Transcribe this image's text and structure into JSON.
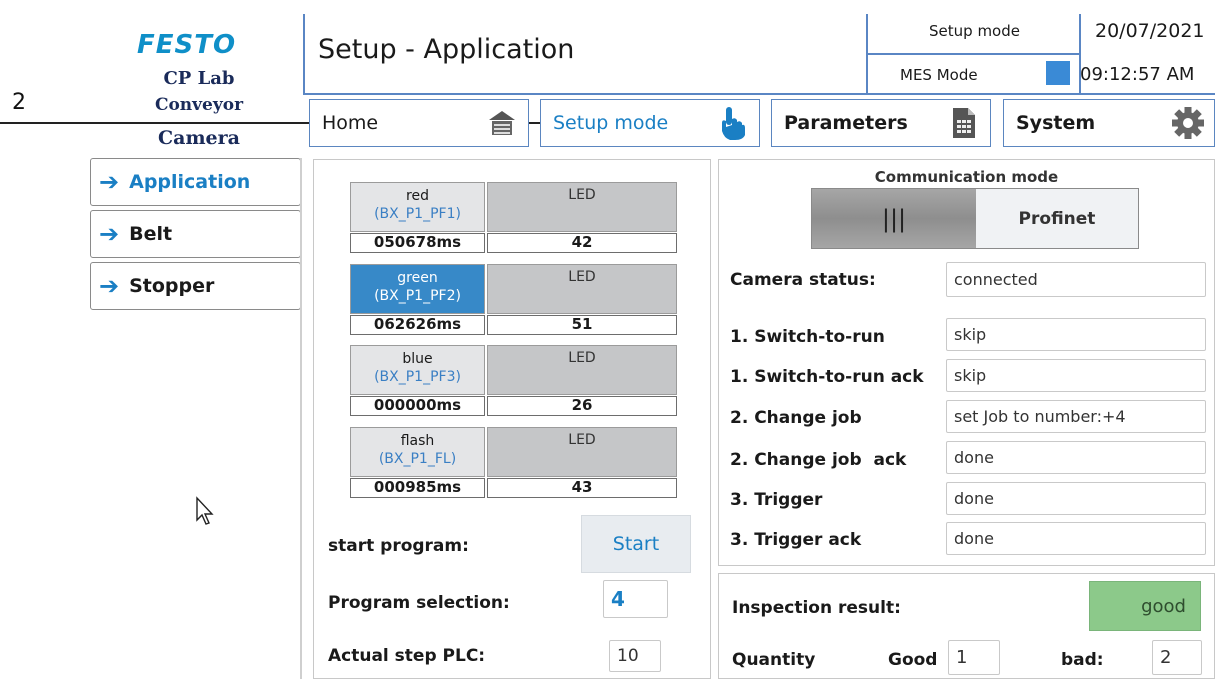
{
  "callout": {
    "number": "2"
  },
  "logo": {
    "brand": "FESTO",
    "product": "CP Lab",
    "station": "Conveyor",
    "module": "Camera"
  },
  "header": {
    "title": "Setup - Application",
    "mode": "Setup mode",
    "mes_label": "MES Mode",
    "date": "20/07/2021",
    "time": "09:12:57 AM",
    "mes_color": "#3a8ad6"
  },
  "nav": {
    "home": {
      "label": "Home",
      "icon": "home-icon"
    },
    "setup": {
      "label": "Setup mode",
      "icon": "hand-pointer-icon"
    },
    "parameters": {
      "label": "Parameters",
      "icon": "document-icon"
    },
    "system": {
      "label": "System",
      "icon": "gear-icon"
    }
  },
  "sidebar": {
    "items": [
      {
        "label": "Application",
        "active": true
      },
      {
        "label": "Belt",
        "active": false
      },
      {
        "label": "Stopper",
        "active": false
      }
    ]
  },
  "leds": [
    {
      "name": "red",
      "signal": "(BX_P1_PF1)",
      "led_label": "LED",
      "time": "050678ms",
      "value": "42",
      "active": false
    },
    {
      "name": "green",
      "signal": "(BX_P1_PF2)",
      "led_label": "LED",
      "time": "062626ms",
      "value": "51",
      "active": true
    },
    {
      "name": "blue",
      "signal": "(BX_P1_PF3)",
      "led_label": "LED",
      "time": "000000ms",
      "value": "26",
      "active": false
    },
    {
      "name": "flash",
      "signal": "(BX_P1_FL)",
      "led_label": "LED",
      "time": "000985ms",
      "value": "43",
      "active": false
    }
  ],
  "program": {
    "start_label": "start program:",
    "start_button": "Start",
    "selection_label": "Program selection:",
    "selection_value": "4",
    "step_label": "Actual step PLC:",
    "step_value": "10"
  },
  "communication": {
    "title": "Communication mode",
    "option_selected": "|||",
    "option_other": "Profinet"
  },
  "status": {
    "camera_label": "Camera status:",
    "camera_value": "connected",
    "rows": [
      {
        "label": "1. Switch-to-run",
        "value": "skip"
      },
      {
        "label": "1. Switch-to-run ack",
        "value": "skip"
      },
      {
        "label": "2. Change job",
        "value": "set Job to number:+4"
      },
      {
        "label": "2. Change job  ack",
        "value": "done"
      },
      {
        "label": "3. Trigger",
        "value": "done"
      },
      {
        "label": "3. Trigger ack",
        "value": "done"
      }
    ]
  },
  "inspection": {
    "label": "Inspection result:",
    "result": "good",
    "result_color": "#8cc98a",
    "quantity_label": "Quantity",
    "good_label": "Good",
    "good_value": "1",
    "bad_label": "bad:",
    "bad_value": "2"
  }
}
